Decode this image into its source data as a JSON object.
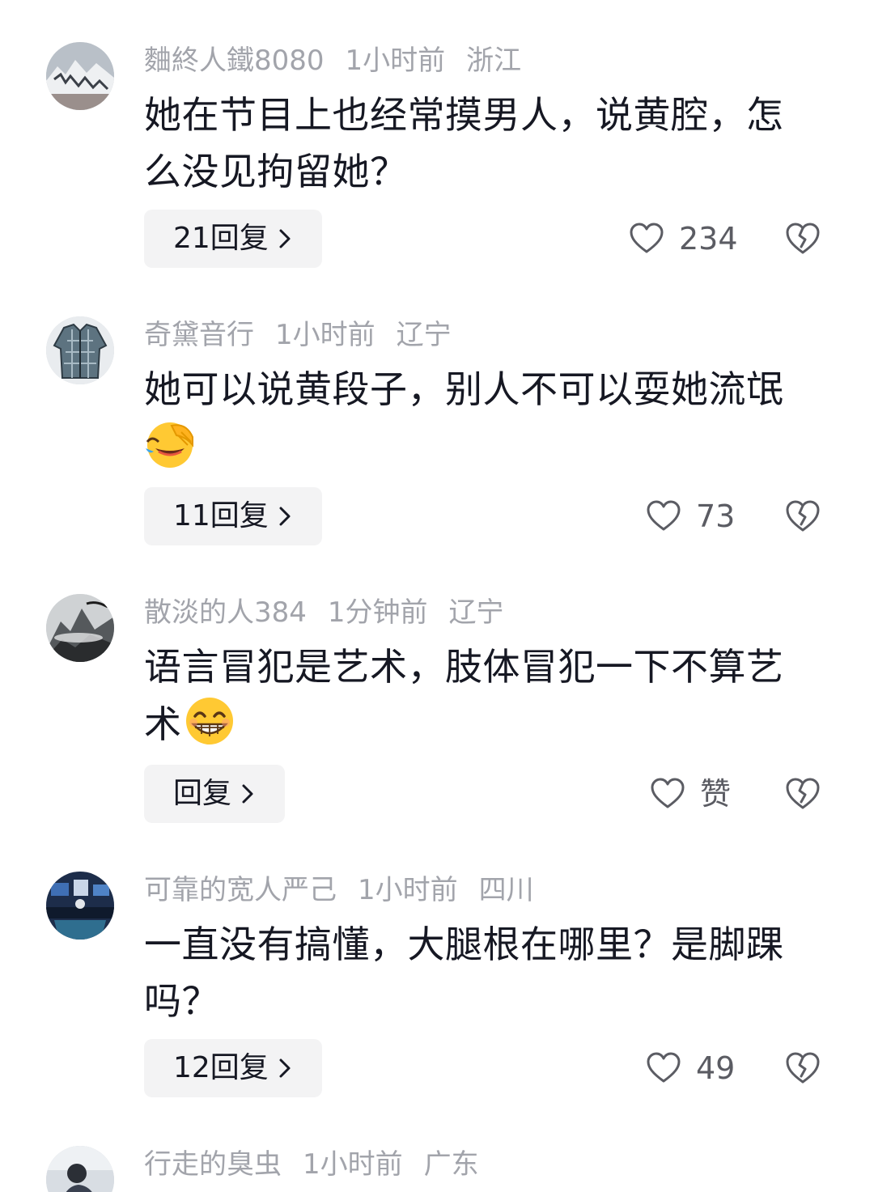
{
  "comments": [
    {
      "username": "麯終人鐵8080",
      "time": "1小时前",
      "location": "浙江",
      "text": "她在节目上也经常摸男人，说黄腔，怎么没见拘留她？",
      "reply_label": "21回复",
      "likes": "234",
      "avatar": "avatar-mountain"
    },
    {
      "username": "奇黛音行",
      "time": "1小时前",
      "location": "辽宁",
      "text": "她可以说黄段子，别人不可以耍她流氓",
      "emoji": "laughing-tears-emoji",
      "reply_label": "11回复",
      "likes": "73",
      "avatar": "avatar-shirt"
    },
    {
      "username": "散淡的人384",
      "time": "1分钟前",
      "location": "辽宁",
      "text": "语言冒犯是艺术，肢体冒犯一下不算艺术",
      "emoji": "grinning-emoji",
      "reply_label": "回复",
      "likes": "赞",
      "avatar": "avatar-misty-peak"
    },
    {
      "username": "可靠的宽人严己",
      "time": "1小时前",
      "location": "四川",
      "text": "一直没有搞懂，大腿根在哪里？是脚踝吗？",
      "reply_label": "12回复",
      "likes": "49",
      "avatar": "avatar-studio"
    },
    {
      "username": "行走的臭虫",
      "time": "1小时前",
      "location": "广东",
      "avatar": "avatar-person"
    }
  ],
  "icons": {
    "like": "heart-outline-icon",
    "dislike": "broken-heart-icon",
    "reply_arrow": "chevron-right-icon"
  },
  "colors": {
    "meta_text": "#a2a4ab",
    "body_text": "#161823",
    "button_bg": "#f3f3f4",
    "icon": "#5b5c63"
  }
}
